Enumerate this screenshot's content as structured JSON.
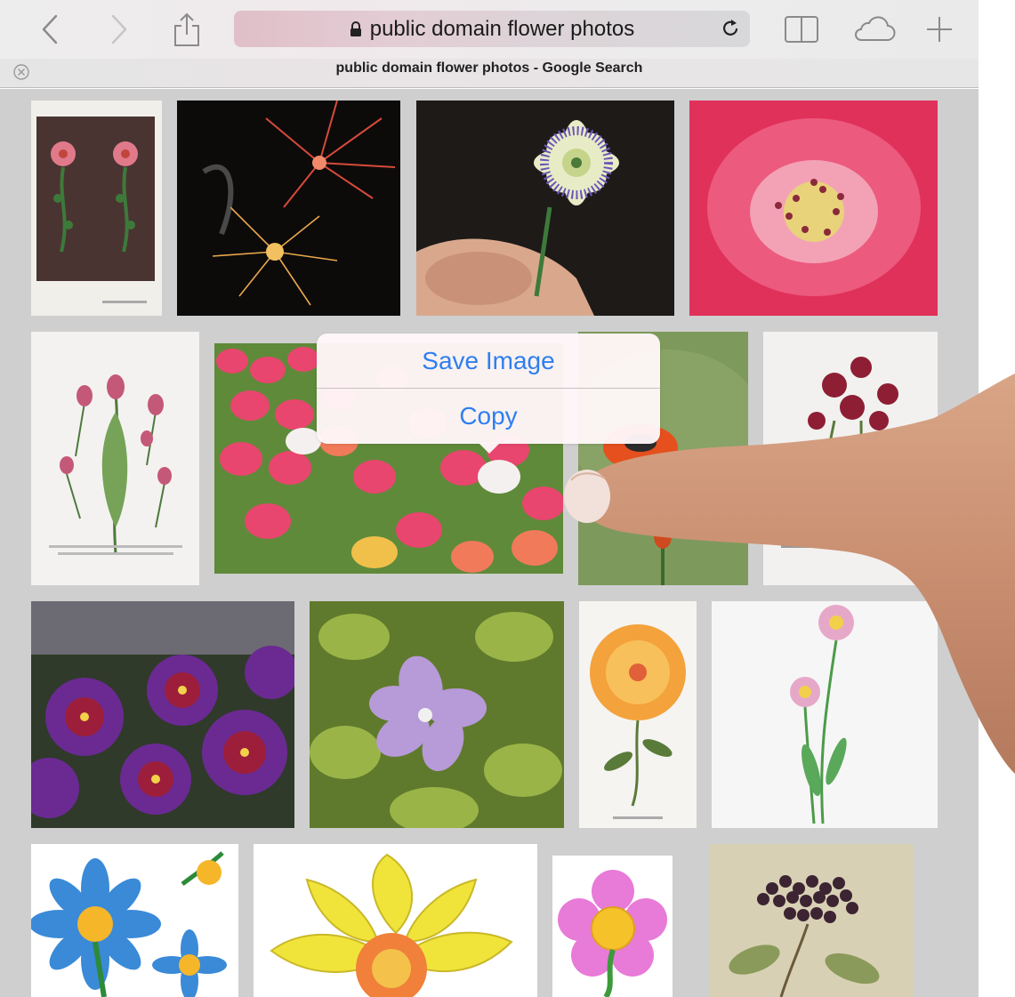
{
  "browser": {
    "address_text": "public domain flower photos",
    "page_title": "public domain flower photos - Google Search"
  },
  "context_menu": {
    "items": [
      {
        "label": "Save Image"
      },
      {
        "label": "Copy"
      }
    ]
  },
  "icons": {
    "back": "chevron-left-icon",
    "forward": "chevron-right-icon",
    "share": "share-icon",
    "lock": "lock-icon",
    "reload": "reload-icon",
    "bookmarks": "open-book-icon",
    "icloud": "cloud-icon",
    "new_tab": "plus-icon",
    "close_tab": "close-icon"
  },
  "colors": {
    "accent": "#2f7ef0",
    "chrome_icon": "#8a8a8a",
    "content_bg": "#cfcfcf"
  },
  "images": [
    {
      "subject": "botanical print roses"
    },
    {
      "subject": "fireworks"
    },
    {
      "subject": "passion flower in hand"
    },
    {
      "subject": "pink rose closeup"
    },
    {
      "subject": "botanical print tulips"
    },
    {
      "subject": "tulip field"
    },
    {
      "subject": "orange poppy"
    },
    {
      "subject": "botanical print carnations"
    },
    {
      "subject": "purple petunias"
    },
    {
      "subject": "periwinkle flower"
    },
    {
      "subject": "botanical print dahlia"
    },
    {
      "subject": "pink asters illustration"
    },
    {
      "subject": "blue daisies clipart"
    },
    {
      "subject": "yellow daffodil clipart"
    },
    {
      "subject": "pink flower clipart"
    },
    {
      "subject": "botanical print elderberry"
    }
  ]
}
